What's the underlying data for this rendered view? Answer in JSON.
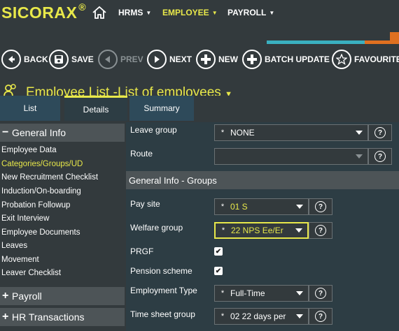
{
  "app": {
    "logo": "SICORAX",
    "registered": "®"
  },
  "nav": {
    "items": [
      {
        "label": "HRMS",
        "active": false
      },
      {
        "label": "EMPLOYEE",
        "active": true
      },
      {
        "label": "PAYROLL",
        "active": false
      }
    ]
  },
  "toolbar": {
    "back": "BACK",
    "save": "SAVE",
    "prev": "PREV",
    "next": "NEXT",
    "new": "NEW",
    "batch_update": "BATCH UPDATE",
    "favourite": "FAVOURITE"
  },
  "page": {
    "title": "Employee List -List of employees"
  },
  "tabs": {
    "list": "List",
    "details": "Details",
    "summary": "Summary"
  },
  "sidebar": {
    "general_info": {
      "sign": "−",
      "label": "General Info"
    },
    "items": [
      {
        "label": "Employee Data",
        "active": false
      },
      {
        "label": "Categories/Groups/UD",
        "active": true
      },
      {
        "label": "New Recruitment Checklist",
        "active": false
      },
      {
        "label": "Induction/On-boarding",
        "active": false
      },
      {
        "label": "Probation Followup",
        "active": false
      },
      {
        "label": "Exit Interview",
        "active": false
      },
      {
        "label": "Employee Documents",
        "active": false
      },
      {
        "label": "Leaves",
        "active": false
      },
      {
        "label": "Movement",
        "active": false
      },
      {
        "label": "Leaver Checklist",
        "active": false
      }
    ],
    "payroll": {
      "sign": "+",
      "label": "Payroll"
    },
    "hr_transactions": {
      "sign": "+",
      "label": "HR Transactions"
    }
  },
  "form": {
    "leave_group": {
      "label": "Leave group",
      "required": "*",
      "value": "NONE"
    },
    "route": {
      "label": "Route",
      "required": "",
      "value": ""
    },
    "section_title": "General Info - Groups",
    "pay_site": {
      "label": "Pay site",
      "required": "*",
      "value": "01 S"
    },
    "welfare_group": {
      "label": "Welfare group",
      "required": "*",
      "value": "22 NPS Ee/Er"
    },
    "prgf": {
      "label": "PRGF",
      "checked": true,
      "mark": "✔"
    },
    "pension_scheme": {
      "label": "Pension scheme",
      "checked": true,
      "mark": "✔"
    },
    "employment_type": {
      "label": "Employment Type",
      "required": "*",
      "value": "Full-Time"
    },
    "time_sheet_group": {
      "label": "Time sheet group",
      "required": "*",
      "value": "02 22 days per"
    }
  },
  "help_glyph": "?",
  "colors": {
    "accent": "#e8e84a",
    "teal": "#3ab0c0",
    "orange": "#e07020",
    "background": "#333a3d",
    "panel": "#2d3d44"
  }
}
